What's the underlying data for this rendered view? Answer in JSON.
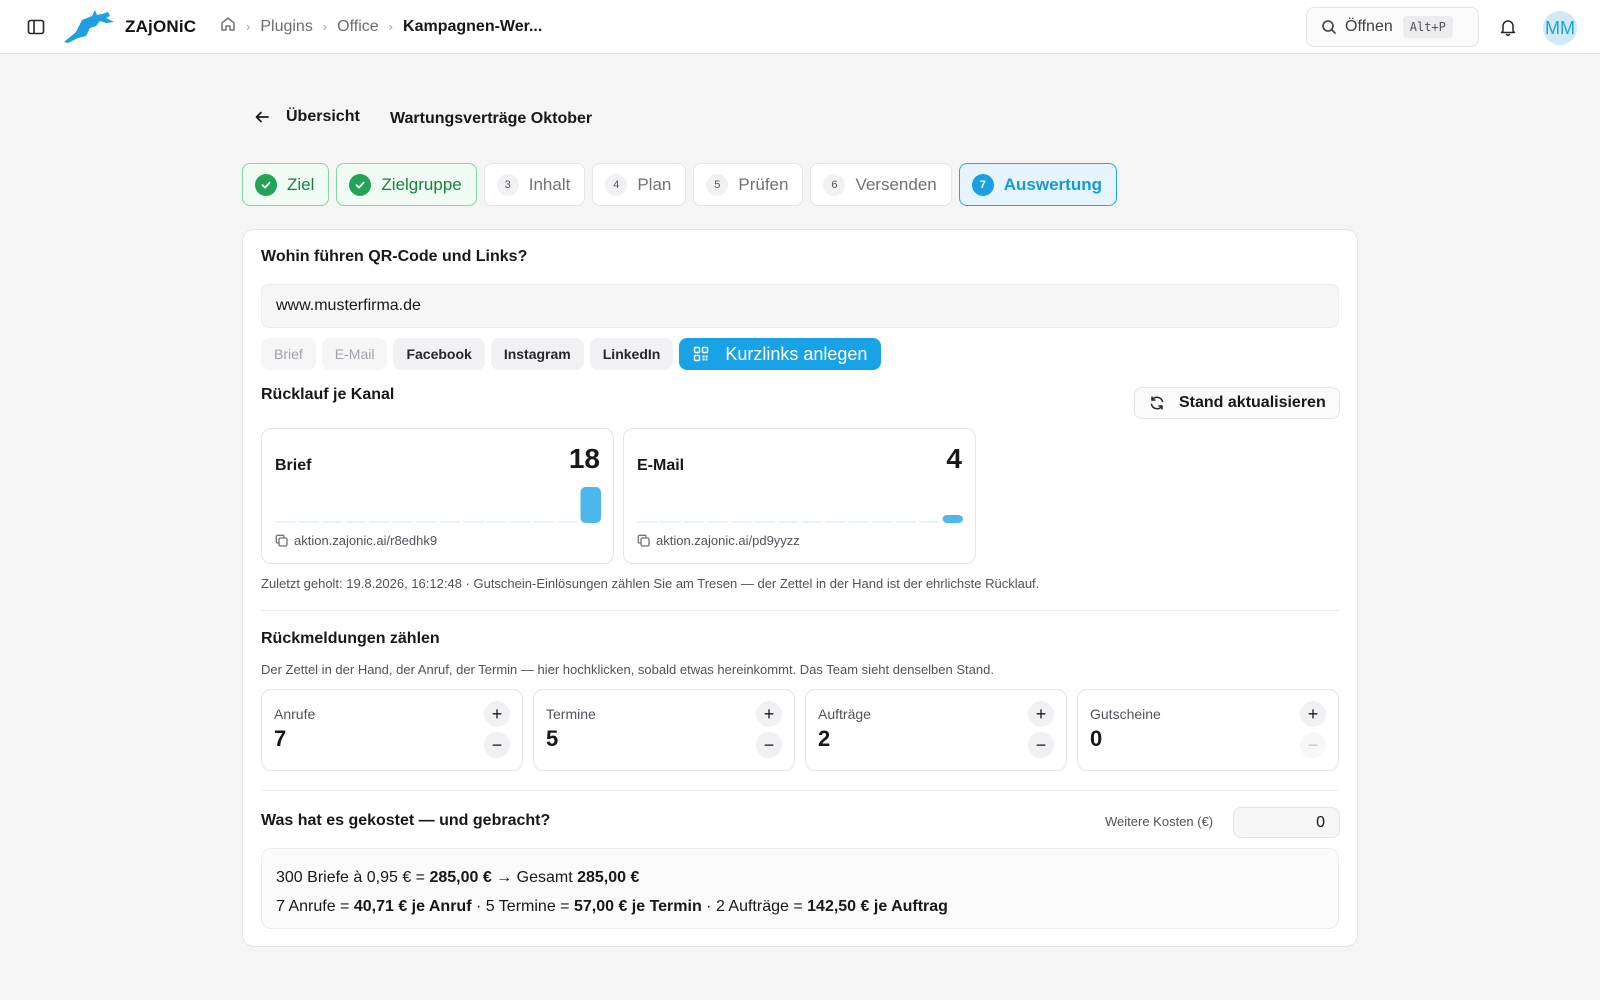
{
  "app": {
    "brand": "ZAjONiC"
  },
  "header": {
    "breadcrumb": [
      "Plugins",
      "Office",
      "Kampagnen-Wer..."
    ],
    "search": {
      "label": "Öffnen",
      "shortcut": "Alt+P"
    },
    "avatar_initials": "MM"
  },
  "page": {
    "back_label": "Übersicht",
    "campaign_title": "Wartungsverträge Oktober"
  },
  "steps": [
    {
      "label": "Ziel",
      "state": "done"
    },
    {
      "label": "Zielgruppe",
      "state": "done"
    },
    {
      "num": "3",
      "label": "Inhalt",
      "state": "todo"
    },
    {
      "num": "4",
      "label": "Plan",
      "state": "todo"
    },
    {
      "num": "5",
      "label": "Prüfen",
      "state": "todo"
    },
    {
      "num": "6",
      "label": "Versenden",
      "state": "todo"
    },
    {
      "num": "7",
      "label": "Auswertung",
      "state": "active"
    }
  ],
  "qr": {
    "title": "Wohin führen QR-Code und Links?",
    "url": "www.musterfirma.de",
    "channels": [
      "Brief",
      "E-Mail",
      "Facebook",
      "Instagram",
      "LinkedIn"
    ],
    "create_button": "Kurzlinks anlegen"
  },
  "ruecklauf": {
    "title": "Rücklauf je Kanal",
    "refresh_button": "Stand aktualisieren",
    "cards": [
      {
        "name": "Brief",
        "count": "18",
        "link": "aktion.zajonic.ai/r8edhk9",
        "spark": [
          0,
          0,
          0,
          0,
          0,
          0,
          0,
          0,
          0,
          0,
          0,
          0,
          0,
          18
        ]
      },
      {
        "name": "E-Mail",
        "count": "4",
        "link": "aktion.zajonic.ai/pd9yyzz",
        "spark": [
          0,
          0,
          0,
          0,
          0,
          0,
          0,
          0,
          0,
          0,
          0,
          0,
          0,
          4
        ]
      }
    ],
    "note": "Zuletzt geholt: 19.8.2026, 16:12:48 · Gutschein-Einlösungen zählen Sie am Tresen — der Zettel in der Hand ist der ehrlichste Rücklauf."
  },
  "rueckmeldungen": {
    "title": "Rückmeldungen zählen",
    "subtitle": "Der Zettel in der Hand, der Anruf, der Termin — hier hochklicken, sobald etwas hereinkommt. Das Team sieht denselben Stand.",
    "counters": [
      {
        "label": "Anrufe",
        "value": "7"
      },
      {
        "label": "Termine",
        "value": "5"
      },
      {
        "label": "Aufträge",
        "value": "2"
      },
      {
        "label": "Gutscheine",
        "value": "0"
      }
    ]
  },
  "kosten": {
    "title": "Was hat es gekostet — und gebracht?",
    "extra_label": "Weitere Kosten (€)",
    "extra_value": "0",
    "line1": {
      "pre": "300 Briefe à 0,95 € = ",
      "amount": "285,00 €",
      "mid": " → Gesamt ",
      "total": "285,00 €"
    },
    "line2": {
      "a1": "7 Anrufe = ",
      "b1": "40,71 € je Anruf",
      "a2": " · 5 Termine = ",
      "b2": "57,00 € je Termin",
      "a3": " · 2 Aufträge = ",
      "b3": "142,50 € je Auftrag"
    }
  },
  "colors": {
    "accent": "#19a2e6",
    "success": "#22a356"
  }
}
